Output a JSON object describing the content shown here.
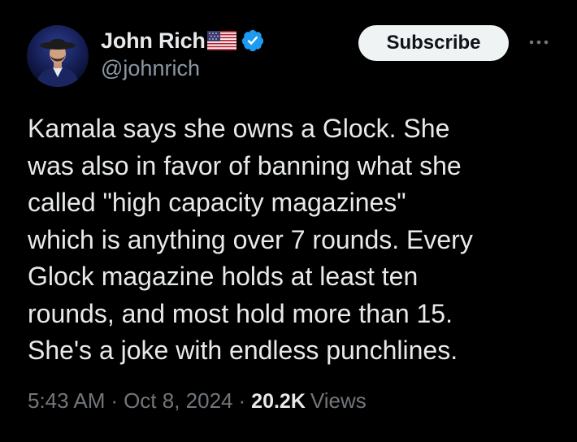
{
  "author": {
    "display_name": "John Rich",
    "handle": "@johnrich"
  },
  "actions": {
    "subscribe_label": "Subscribe"
  },
  "tweet": {
    "text": "Kamala says she owns a Glock. She\nwas also in favor of banning what she\ncalled \"high capacity magazines\"\nwhich is anything over 7 rounds. Every\nGlock magazine holds at least ten\nrounds, and most hold more than 15.\nShe's a joke with endless punchlines."
  },
  "meta": {
    "time": "5:43 AM",
    "separator": "·",
    "date": "Oct 8, 2024",
    "views_count": "20.2K",
    "views_label": "Views"
  },
  "colors": {
    "background": "#000000",
    "primary_text": "#e7e9ea",
    "secondary_text": "#71767b",
    "verified_blue": "#1d9bf0",
    "subscribe_bg": "#eff3f4"
  },
  "icons": {
    "verified": "verified-badge-icon",
    "flag": "us-flag-icon",
    "more": "more-options-icon"
  }
}
